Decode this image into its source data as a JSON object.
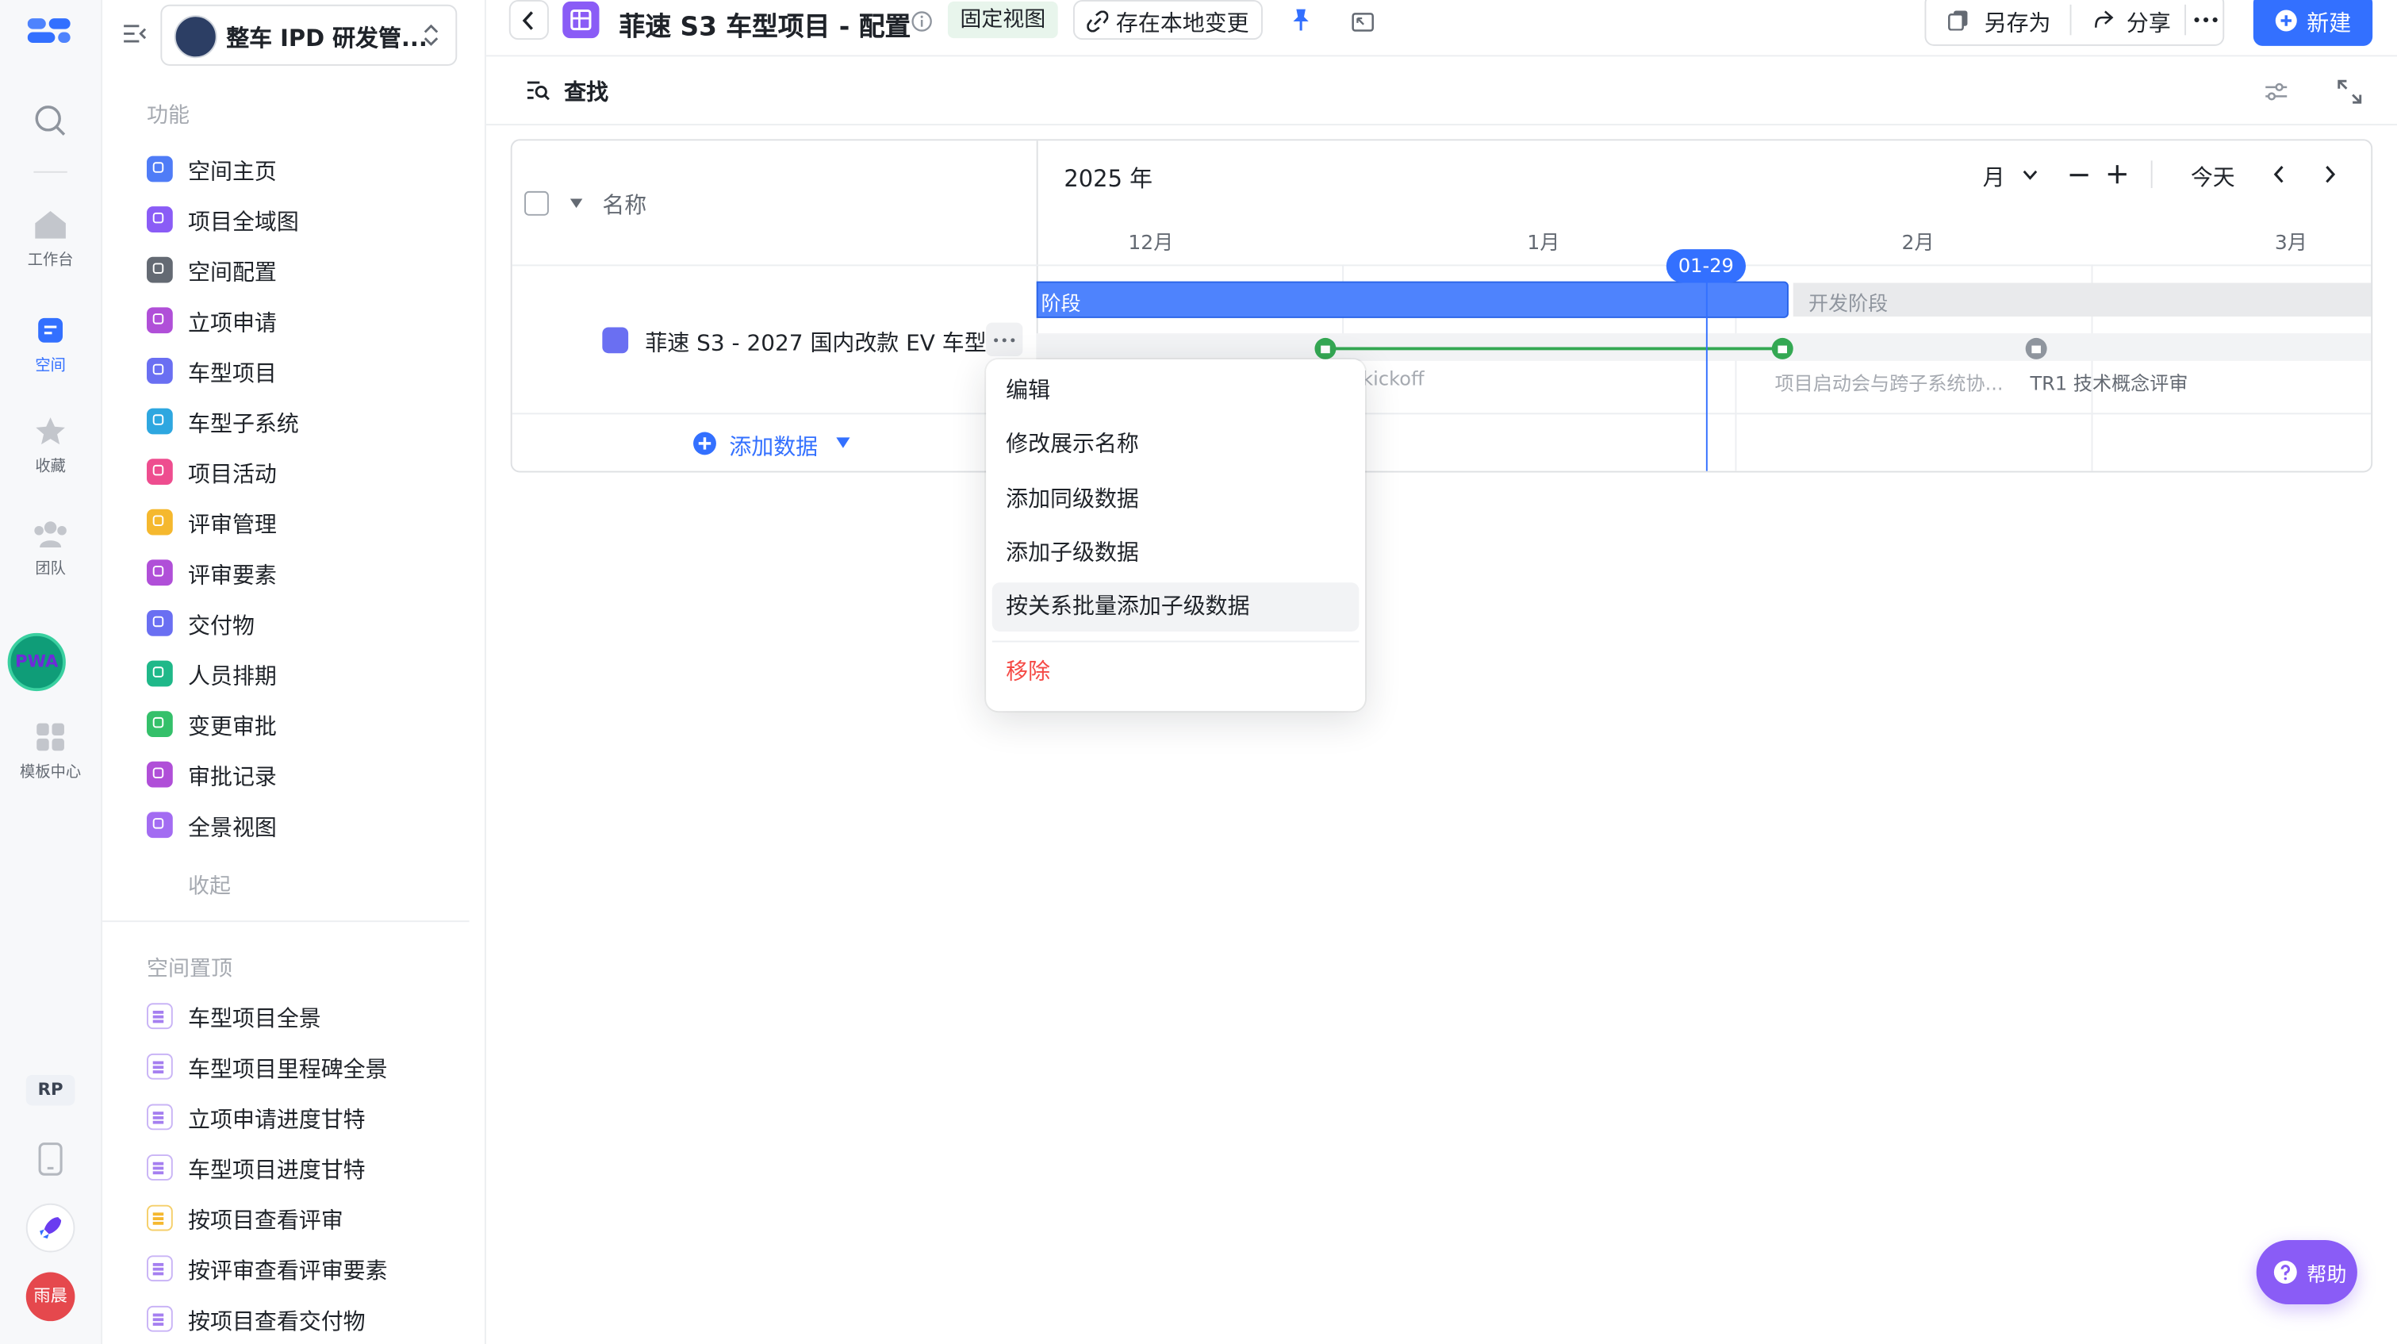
{
  "rail": {
    "items": [
      {
        "label": "工作台"
      },
      {
        "label": "空间"
      },
      {
        "label": "收藏"
      },
      {
        "label": "团队"
      },
      {
        "label": "模板中心"
      }
    ],
    "badge": "PWA",
    "rp": "RP",
    "user": "雨晨"
  },
  "sidebar": {
    "workspace": "整车 IPD 研发管...",
    "section_features": "功能",
    "features": [
      {
        "label": "空间主页",
        "color": "#4f7cf7"
      },
      {
        "label": "项目全域图",
        "color": "#8a5cf6"
      },
      {
        "label": "空间配置",
        "color": "#646a73"
      },
      {
        "label": "立项申请",
        "color": "#b04fd8"
      },
      {
        "label": "车型项目",
        "color": "#6a6ff2"
      },
      {
        "label": "车型子系统",
        "color": "#2ea7e0"
      },
      {
        "label": "项目活动",
        "color": "#ee4d8f"
      },
      {
        "label": "评审管理",
        "color": "#f5b82e"
      },
      {
        "label": "评审要素",
        "color": "#b04fd8"
      },
      {
        "label": "交付物",
        "color": "#6a6ff2"
      },
      {
        "label": "人员排期",
        "color": "#1fb889"
      },
      {
        "label": "变更审批",
        "color": "#34c06a"
      },
      {
        "label": "审批记录",
        "color": "#b04fd8"
      },
      {
        "label": "全景视图",
        "color": "#a36cf2"
      }
    ],
    "collapse": "收起",
    "section_pinned": "空间置顶",
    "pinned": [
      {
        "label": "车型项目全景",
        "color": "#a57ff0"
      },
      {
        "label": "车型项目里程碑全景",
        "color": "#a57ff0"
      },
      {
        "label": "立项申请进度甘特",
        "color": "#a57ff0"
      },
      {
        "label": "车型项目进度甘特",
        "color": "#a57ff0"
      },
      {
        "label": "按项目查看评审",
        "color": "#f5b82e"
      },
      {
        "label": "按评审查看评审要素",
        "color": "#a57ff0"
      },
      {
        "label": "按项目查看交付物",
        "color": "#a57ff0"
      }
    ]
  },
  "header": {
    "title": "菲速 S3 车型项目 - 配置",
    "fixed_view": "固定视图",
    "local_changes": "存在本地变更",
    "save_as": "另存为",
    "share": "分享",
    "new": "新建"
  },
  "toolbar": {
    "search": "查找"
  },
  "gantt": {
    "name_header": "名称",
    "row_name": "菲速 S3 - 2027 国内改款 EV 车型",
    "add_data": "添加数据",
    "year": "2025 年",
    "scale": "月",
    "today": "今天",
    "months": [
      "12月",
      "1月",
      "2月",
      "3月"
    ],
    "today_marker": "01-29",
    "phase_1": "阶段",
    "phase_2": "开发阶段",
    "milestones": [
      "kickoff",
      "项目启动会与跨子系统协...",
      "TR1 技术概念评审"
    ]
  },
  "menu": {
    "items": [
      "编辑",
      "修改展示名称",
      "添加同级数据",
      "添加子级数据",
      "按关系批量添加子级数据"
    ],
    "danger": "移除"
  },
  "help": "帮助",
  "colors": {
    "primary": "#3370ff",
    "accent": "#4e83fd",
    "milestone": "#34a853",
    "danger": "#f54a45"
  }
}
